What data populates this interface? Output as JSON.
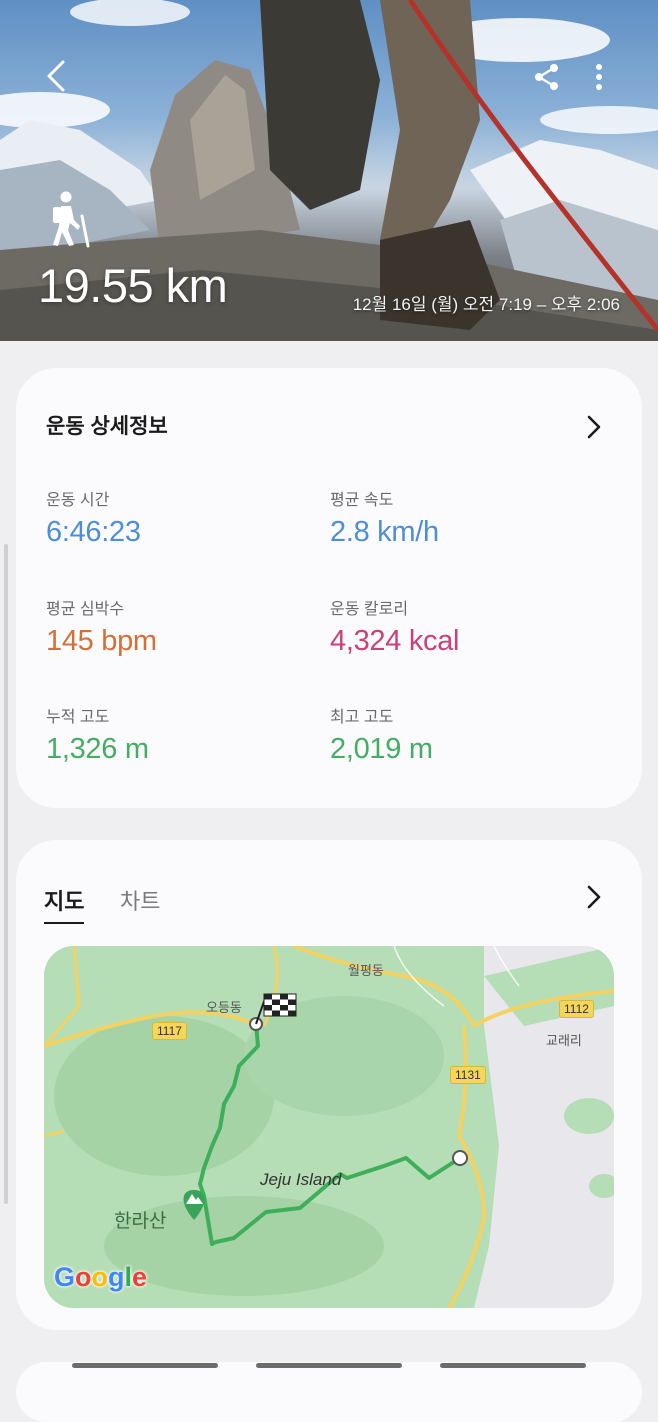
{
  "header": {
    "distance": "19.55 km",
    "datetime": "12월 16일 (월) 오전 7:19 – 오후 2:06",
    "icons": [
      "back-icon",
      "share-icon",
      "more-vertical-icon",
      "hiking-icon"
    ]
  },
  "details": {
    "title": "운동 상세정보",
    "stats": [
      {
        "label": "운동 시간",
        "value": "6:46:23",
        "color": "#4e8ed7"
      },
      {
        "label": "평균 속도",
        "value": "2.8 km/h",
        "color": "#4e8ed7"
      },
      {
        "label": "평균 심박수",
        "value": "145 bpm",
        "color": "#d3703a"
      },
      {
        "label": "운동 칼로리",
        "value": "4,324 kcal",
        "color": "#c9407a"
      },
      {
        "label": "누적 고도",
        "value": "1,326 m",
        "color": "#45ad63"
      },
      {
        "label": "최고 고도",
        "value": "2,019 m",
        "color": "#45ad63"
      }
    ]
  },
  "map_card": {
    "tabs": [
      "지도",
      "차트"
    ],
    "active_tab": "지도",
    "map": {
      "place_labels": [
        "월평동",
        "오등동",
        "교래리",
        "Jeju Island",
        "한라산"
      ],
      "road_numbers": [
        "1117",
        "1112",
        "1131"
      ],
      "attribution": "Google"
    }
  },
  "colors": {
    "time_speed": "#4e8ed7",
    "heart_rate": "#d3703a",
    "calories": "#c9407a",
    "altitude": "#45ad63",
    "route": "#3fae5a"
  }
}
